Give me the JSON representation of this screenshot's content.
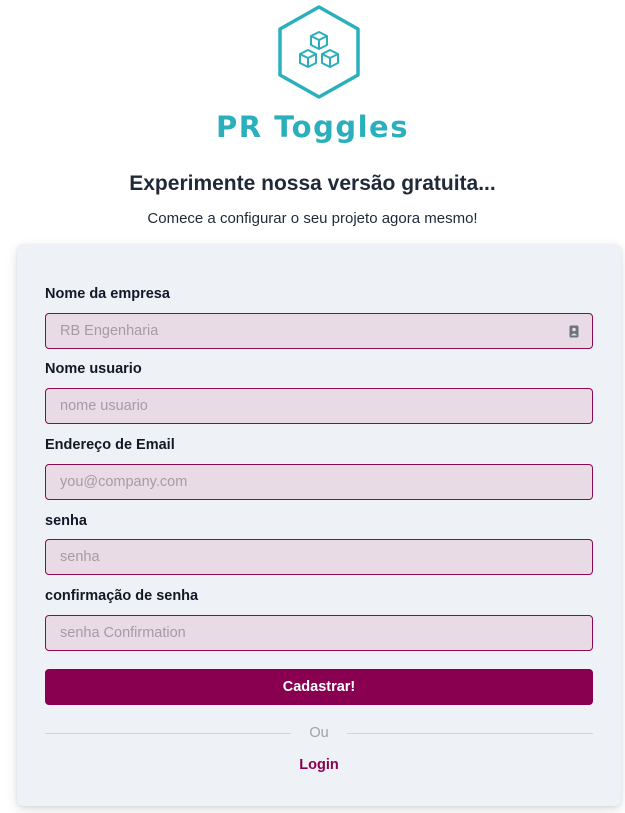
{
  "brand": {
    "name": "PR Toggles",
    "color": "#2ab0bd",
    "logo_icon": "cubes-hexagon-icon"
  },
  "header": {
    "headline": "Experimente nossa versão gratuita...",
    "subline": "Comece a configurar o seu projeto agora mesmo!"
  },
  "form": {
    "company": {
      "label": "Nome da empresa",
      "placeholder": "RB Engenharia",
      "icon": "contact-badge-icon"
    },
    "username": {
      "label": "Nome usuario",
      "placeholder": "nome usuario"
    },
    "email": {
      "label": "Endereço de Email",
      "placeholder": "you@company.com"
    },
    "password": {
      "label": "senha",
      "placeholder": "senha"
    },
    "password_confirm": {
      "label": "confirmação de senha",
      "placeholder": "senha Confirmation"
    },
    "submit_label": "Cadastrar!",
    "divider_text": "Ou",
    "login_label": "Login"
  },
  "colors": {
    "accent": "#8a0050",
    "field_bg": "#e9dbe6",
    "card_bg": "#eef1f5"
  }
}
